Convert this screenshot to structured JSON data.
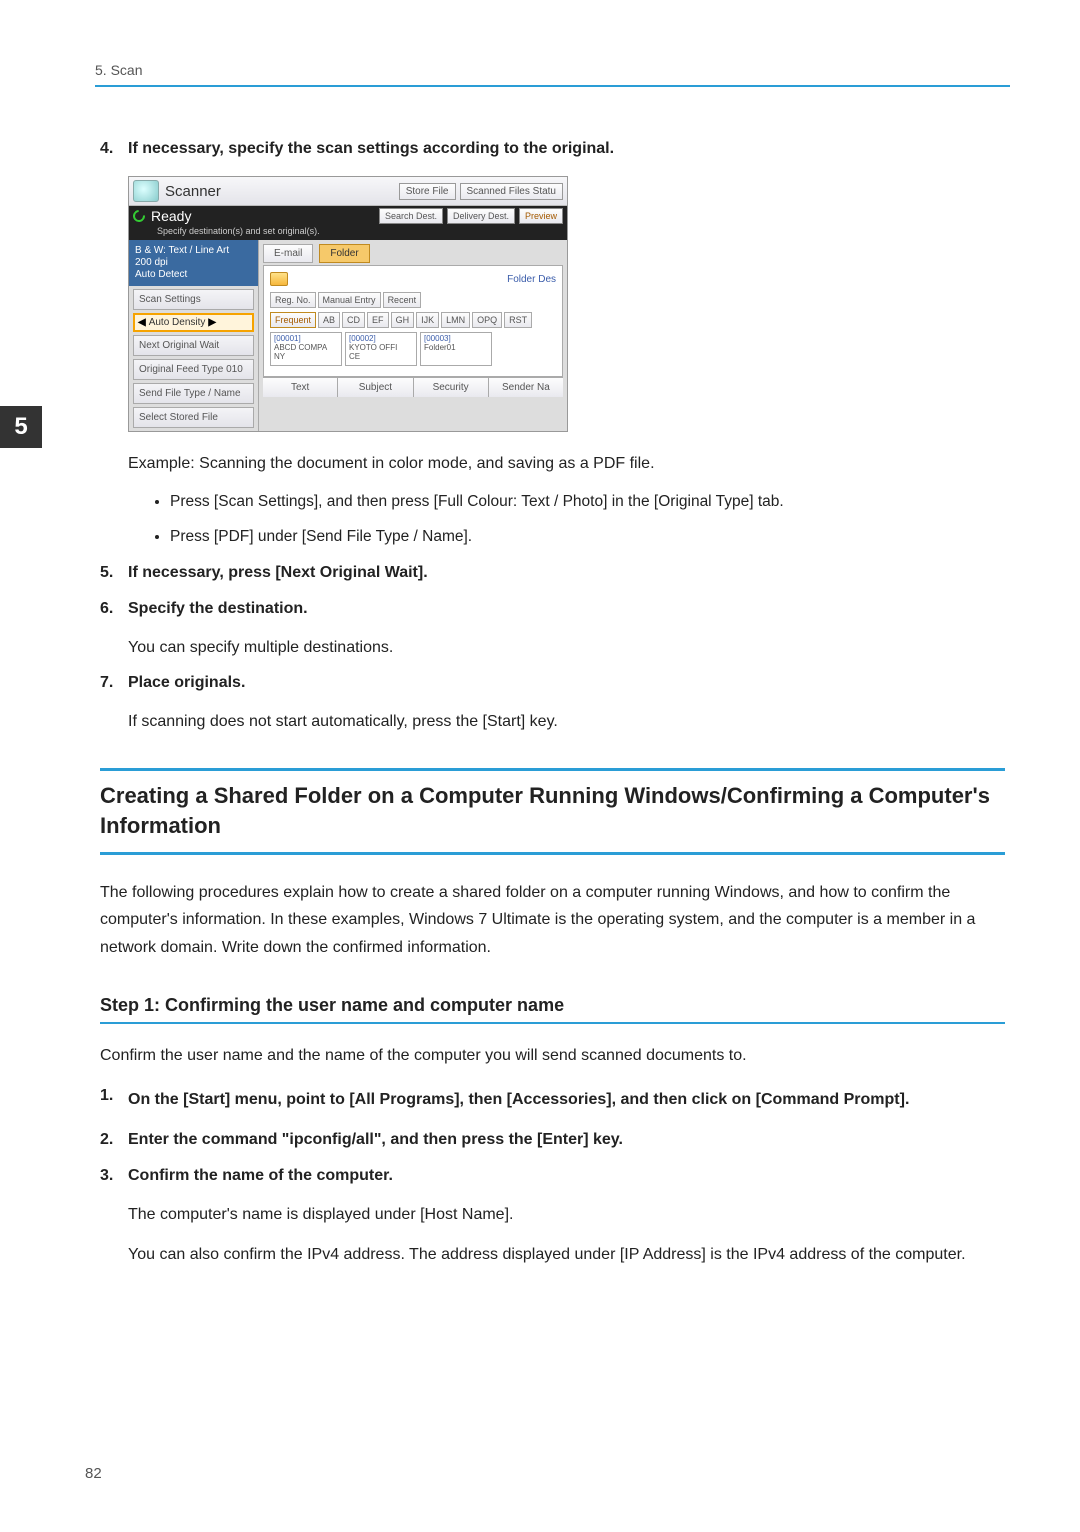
{
  "header": {
    "chapter": "5. Scan"
  },
  "tab": {
    "number": "5"
  },
  "page_number": "82",
  "steps": {
    "s4": {
      "num": "4.",
      "text": "If necessary, specify the scan settings according to the original.",
      "example": "Example: Scanning the document in color mode, and saving as a PDF file.",
      "bullets": [
        "Press [Scan Settings], and then press [Full Colour: Text / Photo] in the [Original Type] tab.",
        "Press [PDF] under [Send File Type / Name]."
      ]
    },
    "s5": {
      "num": "5.",
      "text": "If necessary, press [Next Original Wait]."
    },
    "s6": {
      "num": "6.",
      "text": "Specify the destination.",
      "desc": "You can specify multiple destinations."
    },
    "s7": {
      "num": "7.",
      "text": "Place originals.",
      "desc": "If scanning does not start automatically, press the [Start] key."
    }
  },
  "section2": {
    "title": "Creating a Shared Folder on a Computer Running Windows/Confirming a Computer's Information",
    "para": "The following procedures explain how to create a shared folder on a computer running Windows, and how to confirm the computer's information. In these examples, Windows 7 Ultimate is the operating system, and the computer is a member in a network domain. Write down the confirmed information."
  },
  "section3": {
    "title": "Step 1: Confirming the user name and computer name",
    "para": "Confirm the user name and the name of the computer you will send scanned documents to.",
    "steps": {
      "s1": {
        "num": "1.",
        "text": "On the [Start] menu, point to [All Programs], then [Accessories], and then click on [Command Prompt]."
      },
      "s2": {
        "num": "2.",
        "text": "Enter the command \"ipconfig/all\", and then press the [Enter] key."
      },
      "s3": {
        "num": "3.",
        "text": "Confirm the name of the computer.",
        "desc1": "The computer's name is displayed under [Host Name].",
        "desc2": "You can also confirm the IPv4 address. The address displayed under [IP Address] is the IPv4 address of the computer."
      }
    }
  },
  "scanner_ui": {
    "title": "Scanner",
    "top_buttons": {
      "store": "Store File",
      "status": "Scanned Files Statu"
    },
    "status": {
      "ready": "Ready",
      "search": "Search Dest.",
      "delivery": "Delivery Dest.",
      "preview": "Preview",
      "specify": "Specify destination(s) and set original(s)."
    },
    "left_panel": {
      "header1": "B & W: Text / Line Art",
      "header2": "200 dpi",
      "header3": "Auto Detect",
      "scan_settings": "Scan Settings",
      "auto_density": "Auto Density",
      "next_wait": "Next Original Wait",
      "feed_type": "Original Feed Type",
      "file_type": "Send File Type / Name",
      "stored": "Select Stored File",
      "icon_suffix": "010"
    },
    "right_panel": {
      "tab_email": "E-mail",
      "tab_folder": "Folder",
      "folder_des": "Folder Des",
      "reg_tabs": {
        "reg": "Reg. No.",
        "manual": "Manual Entry",
        "recent": "Recent"
      },
      "alpha": [
        "Frequent",
        "AB",
        "CD",
        "EF",
        "GH",
        "IJK",
        "LMN",
        "OPQ",
        "RST"
      ],
      "dest": [
        {
          "tag": "[00001]",
          "l1": "ABCD COMPA",
          "l2": "NY"
        },
        {
          "tag": "[00002]",
          "l1": "KYOTO OFFI",
          "l2": "CE"
        },
        {
          "tag": "[00003]",
          "l1": "Folder01",
          "l2": ""
        }
      ],
      "bottom_tabs": {
        "text": "Text",
        "subject": "Subject",
        "security": "Security",
        "sender": "Sender Na"
      }
    }
  }
}
